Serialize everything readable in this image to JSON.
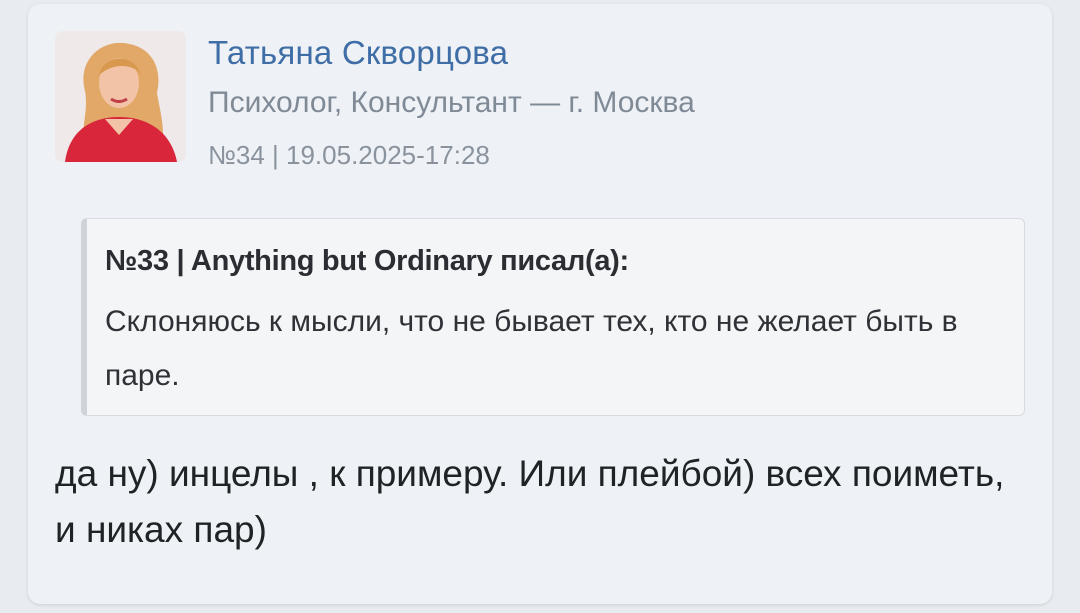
{
  "author": {
    "name": "Татьяна Скворцова",
    "role": "Психолог, Консультант — г. Москва",
    "post_meta": "№34 | 19.05.2025-17:28",
    "avatar_icon": "user-photo"
  },
  "quote": {
    "header": "№33 | Anything but Ordinary писал(а):",
    "text": "Склоняюсь к мысли, что не бывает тех, кто не желает быть в паре."
  },
  "post": {
    "text": "да ну) инцелы , к примеру. Или плейбой) всех поиметь, и никах пар)"
  },
  "colors": {
    "name_link": "#3f6ea6",
    "muted_text": "#7f8a96",
    "card_bg": "#eef1f5",
    "quote_bg": "#f4f5f7"
  }
}
